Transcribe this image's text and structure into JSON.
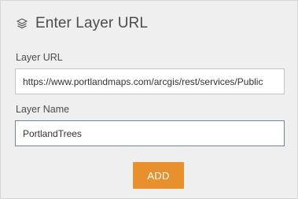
{
  "dialog": {
    "title": "Enter Layer URL",
    "icon": "layers-icon"
  },
  "layer_url": {
    "label": "Layer URL",
    "value": "https://www.portlandmaps.com/arcgis/rest/services/Public"
  },
  "layer_name": {
    "label": "Layer Name",
    "value": "PortlandTrees"
  },
  "add_button": {
    "label": "ADD"
  },
  "colors": {
    "accent": "#e8902e",
    "panel_background": "#efefef",
    "text": "#4c4c4c"
  }
}
